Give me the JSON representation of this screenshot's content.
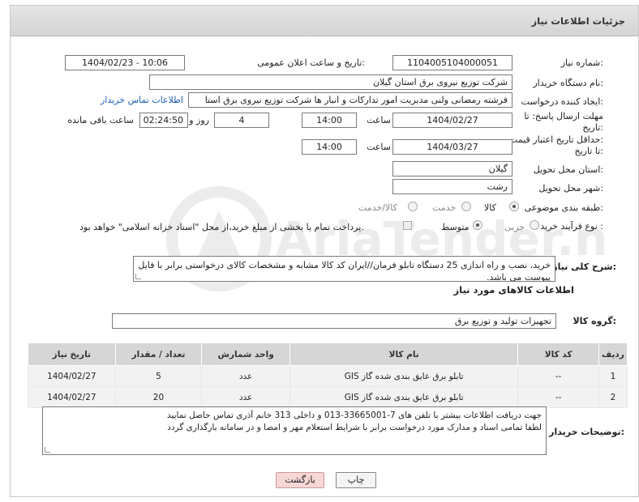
{
  "header": {
    "title": "جزئیات اطلاعات نیاز"
  },
  "fields": {
    "need_number_label": "شماره نیاز:",
    "need_number": "1104005104000051",
    "announce_label": "تاریخ و ساعت اعلان عمومی:",
    "announce_value": "1404/02/23 - 10:06",
    "buyer_org_label": "نام دستگاه خریدار:",
    "buyer_org": "شرکت توزیع نیروی برق استان گیلان",
    "creator_label": "ایجاد کننده درخواست:",
    "creator": "فرشته رمضانی ولنی مدیریت امور تدارکات و انبار ها شرکت توزیع نیروی برق استا",
    "contact_link": "اطلاعات تماس خریدار",
    "reply_deadline_label_1": "مهلت ارسال پاسخ: تا",
    "reply_deadline_label_2": "تاریخ:",
    "reply_date": "1404/02/27",
    "time_label": "ساعت",
    "reply_time": "14:00",
    "days_value": "4",
    "days_label": "روز و",
    "remaining_time": "02:24:50",
    "remaining_label": "ساعت باقی مانده",
    "price_deadline_label_1": "حداقل تاریخ اعتبار قیمت:",
    "price_deadline_label_2": "تا تاریخ:",
    "price_date": "1404/03/27",
    "price_time": "14:00",
    "province_label": "استان محل تحویل:",
    "province": "گیلان",
    "city_label": "شهر محل تحویل:",
    "city": "رشت",
    "category_label": "طبقه بندی موضوعی:",
    "category_options": [
      "کالا",
      "خدمت",
      "کالا/خدمت"
    ],
    "process_label": "نوع فرآیند خرید :",
    "process_options": [
      "جزیی",
      "متوسط"
    ],
    "payment_note": "پرداخت تمام یا بخشی از مبلغ خرید،از محل \"اسناد خزانه اسلامی\" خواهد بود.",
    "description_label": "شرح کلی نیاز:",
    "description": "خرید، نصب و راه اندازی 25 دستگاه تابلو فرمان//ایران کد کالا مشابه و مشخصات کالای درخواستی برابر با فایل پیوست می باشد."
  },
  "goods": {
    "section_title": "اطلاعات کالاهای مورد نیاز",
    "group_label": "گروه کالا:",
    "group_value": "تجهیزات تولید و توزیع برق",
    "columns": [
      "ردیف",
      "کد کالا",
      "نام کالا",
      "واحد شمارش",
      "تعداد / مقدار",
      "تاریخ نیاز"
    ],
    "rows": [
      [
        "1",
        "--",
        "تابلو برق عایق بندی شده گاز GIS",
        "عدد",
        "5",
        "1404/02/27"
      ],
      [
        "2",
        "--",
        "تابلو برق عایق بندی شده گاز GIS",
        "عدد",
        "20",
        "1404/02/27"
      ]
    ]
  },
  "buyer_notes": {
    "label": "توضیحات خریدار:",
    "line1": "جهت دریافت اطلاعات بیشتر با تلفن های 7-33665001-013 و داخلی 313 خانم آذری تماس حاصل نمایید",
    "line2": "لطفا تمامی اسناد و مدارک مورد درخواست برابر با شرایط استعلام مهر و امضا و در سامانه بارگذاری گردد"
  },
  "buttons": {
    "print": "چاپ",
    "back": "بازگشت"
  },
  "watermark": {
    "text": "AriaTender.neT"
  },
  "colors": {
    "link": "#1a5fb4",
    "header_bg": "#d9d9d9",
    "back_button_bg": "#f7d6d6"
  }
}
